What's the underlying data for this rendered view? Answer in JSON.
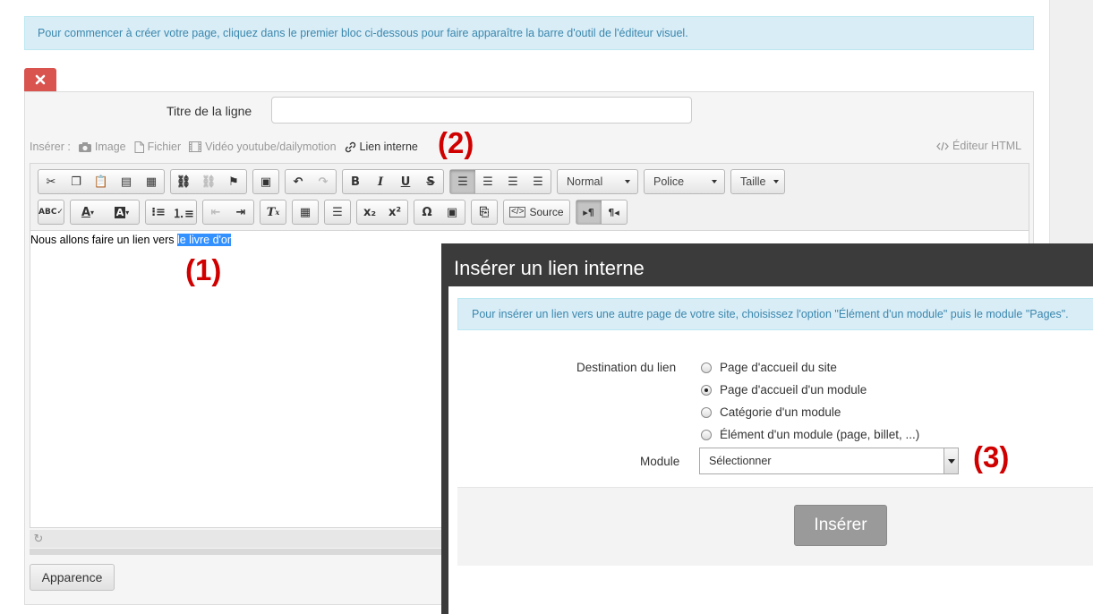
{
  "info_banner": "Pour commencer à créer votre page, cliquez dans le premier bloc ci-dessous pour faire apparaître la barre d'outil de l'éditeur visuel.",
  "row": {
    "title_label": "Titre de la ligne",
    "title_value": ""
  },
  "insert_bar": {
    "label": "Insérer :",
    "image": "Image",
    "file": "Fichier",
    "video": "Vidéo youtube/dailymotion",
    "internal_link": "Lien interne",
    "html_editor": "Éditeur HTML"
  },
  "annotations": {
    "a1": "(1)",
    "a2": "(2)",
    "a3": "(3)"
  },
  "toolbar": {
    "bold": "B",
    "italic": "I",
    "underline": "U",
    "strike": "S",
    "format_combo": "Normal",
    "font_combo": "Police",
    "size_combo": "Taille",
    "source": "Source",
    "omega": "Ω",
    "sub": "x₂",
    "sup": "x²",
    "ltr": "▸¶",
    "rtl": "¶◂"
  },
  "editor": {
    "text_before": "Nous allons faire un lien vers ",
    "text_selected": "le livre d'or"
  },
  "appearance_button": "Apparence",
  "modal": {
    "title": "Insérer un lien interne",
    "info": "Pour insérer un lien vers une autre page de votre site, choisissez l'option \"Élément d'un module\" puis le module \"Pages\".",
    "destination_label": "Destination du lien",
    "options": [
      {
        "label": "Page d'accueil du site",
        "checked": false
      },
      {
        "label": "Page d'accueil d'un module",
        "checked": true
      },
      {
        "label": "Catégorie d'un module",
        "checked": false
      },
      {
        "label": "Élément d'un module (page, billet, ...)",
        "checked": false
      }
    ],
    "module_label": "Module",
    "module_selected": "Sélectionner",
    "insert_button": "Insérer"
  },
  "colors": {
    "accent_red": "#d00000",
    "delete": "#d9534f",
    "info_bg": "#d9edf7",
    "modal_header": "#3b3b3b"
  }
}
